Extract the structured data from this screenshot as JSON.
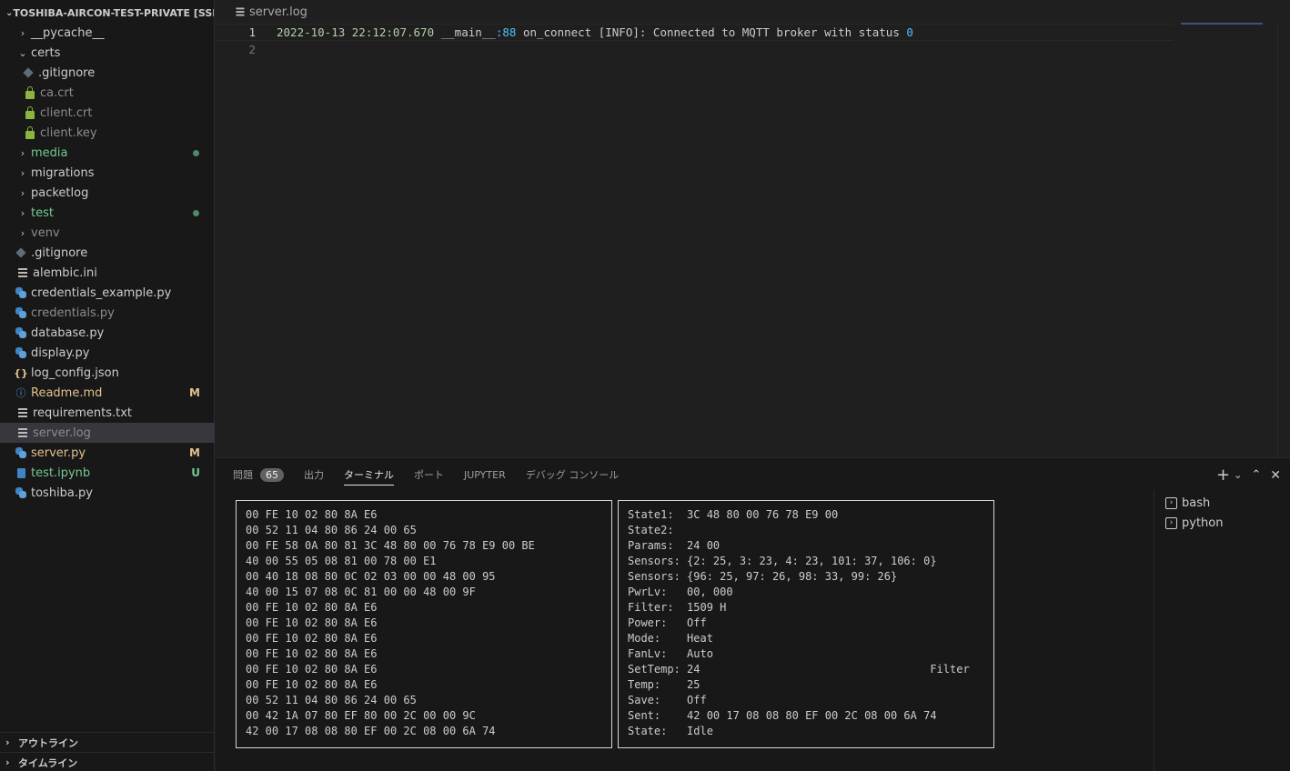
{
  "explorer": {
    "title": "TOSHIBA-AIRCON-TEST-PRIVATE [SSH: ...",
    "items": [
      {
        "label": "__pycache__",
        "type": "folder",
        "expanded": false
      },
      {
        "label": "certs",
        "type": "folder",
        "expanded": true
      },
      {
        "label": ".gitignore",
        "type": "file-git"
      },
      {
        "label": "ca.crt",
        "type": "file-lock"
      },
      {
        "label": "client.crt",
        "type": "file-lock"
      },
      {
        "label": "client.key",
        "type": "file-lock"
      },
      {
        "label": "media",
        "type": "folder",
        "status": "dot"
      },
      {
        "label": "migrations",
        "type": "folder"
      },
      {
        "label": "packetlog",
        "type": "folder"
      },
      {
        "label": "test",
        "type": "folder",
        "status": "dot"
      },
      {
        "label": "venv",
        "type": "folder"
      },
      {
        "label": ".gitignore",
        "type": "file-git"
      },
      {
        "label": "alembic.ini",
        "type": "file-text"
      },
      {
        "label": "credentials_example.py",
        "type": "file-python"
      },
      {
        "label": "credentials.py",
        "type": "file-python"
      },
      {
        "label": "database.py",
        "type": "file-python"
      },
      {
        "label": "display.py",
        "type": "file-python"
      },
      {
        "label": "log_config.json",
        "type": "file-json"
      },
      {
        "label": "Readme.md",
        "type": "file-info",
        "badge": "M"
      },
      {
        "label": "requirements.txt",
        "type": "file-text"
      },
      {
        "label": "server.log",
        "type": "file-text",
        "selected": true
      },
      {
        "label": "server.py",
        "type": "file-python",
        "badge": "M"
      },
      {
        "label": "test.ipynb",
        "type": "file-notebook",
        "badge": "U"
      },
      {
        "label": "toshiba.py",
        "type": "file-python"
      }
    ],
    "outline": "アウトライン",
    "timeline": "タイムライン"
  },
  "editor": {
    "breadcrumb": "server.log",
    "lines": [
      {
        "number": "1",
        "date": "2022-10-13 22:12:07.670",
        "module": "__main__",
        "lineno": ":88",
        "message": " on_connect [INFO]: Connected to MQTT broker with status ",
        "status": "0"
      },
      {
        "number": "2"
      }
    ]
  },
  "panel": {
    "tabs": [
      {
        "label": "問題",
        "count": "65"
      },
      {
        "label": "出力"
      },
      {
        "label": "ターミナル",
        "active": true
      },
      {
        "label": "ポート"
      },
      {
        "label": "JUPYTER"
      },
      {
        "label": "デバッグ コンソール"
      }
    ],
    "terminal_left": [
      "00 FE 10 02 80 8A E6",
      "00 52 11 04 80 86 24 00 65",
      "00 FE 58 0A 80 81 3C 48 80 00 76 78 E9 00 BE",
      "40 00 55 05 08 81 00 78 00 E1",
      "00 40 18 08 80 0C 02 03 00 00 48 00 95",
      "40 00 15 07 08 0C 81 00 00 48 00 9F",
      "00 FE 10 02 80 8A E6",
      "00 FE 10 02 80 8A E6",
      "00 FE 10 02 80 8A E6",
      "00 FE 10 02 80 8A E6",
      "00 FE 10 02 80 8A E6",
      "00 FE 10 02 80 8A E6",
      "00 52 11 04 80 86 24 00 65",
      "00 42 1A 07 80 EF 80 00 2C 00 00 9C",
      "42 00 17 08 08 80 EF 00 2C 08 00 6A 74"
    ],
    "terminal_right": [
      "State1:  3C 48 80 00 76 78 E9 00",
      "State2:",
      "Params:  24 00",
      "Sensors: {2: 25, 3: 23, 4: 23, 101: 37, 106: 0}",
      "Sensors: {96: 25, 97: 26, 98: 33, 99: 26}",
      "PwrLv:   00, 000",
      "Filter:  1509 H",
      "Power:   Off",
      "Mode:    Heat",
      "FanLv:   Auto",
      "SetTemp: 24                                   Filter",
      "Temp:    25",
      "Save:    Off",
      "Sent:    42 00 17 08 08 80 EF 00 2C 08 00 6A 74",
      "State:   Idle"
    ],
    "terminals": [
      {
        "label": "bash"
      },
      {
        "label": "python"
      }
    ]
  }
}
